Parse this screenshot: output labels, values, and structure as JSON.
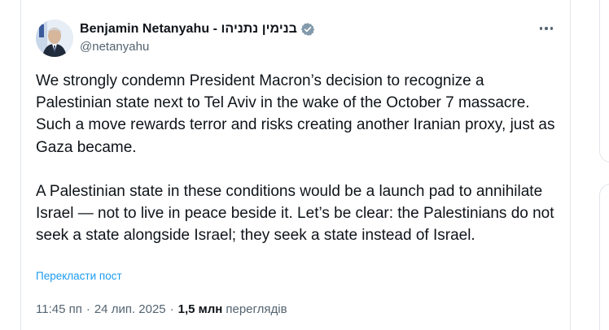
{
  "author": {
    "display_name": "Benjamin Netanyahu - בנימין נתניהו",
    "handle": "@netanyahu",
    "verified_icon": "verified-badge-gray",
    "avatar_icon": "profile-photo"
  },
  "menu": {
    "more_icon": "more-horizontal-icon"
  },
  "tweet": {
    "paragraph_1": "We strongly condemn President Macron’s decision to recognize a Palestinian state next to Tel Aviv in the wake of the October 7 massacre. Such a move rewards terror and risks creating another Iranian proxy, just as Gaza became.",
    "paragraph_2": "A Palestinian state in these conditions would be a launch pad to annihilate Israel — not to live in peace beside it. Let’s be clear: the Palestinians do not seek a state alongside Israel; they seek a state instead of Israel."
  },
  "translate_link": "Перекласти пост",
  "meta": {
    "time": "11:45 пп",
    "separator": "·",
    "date": "24 лип. 2025",
    "views_count": "1,5 млн",
    "views_label": "переглядів"
  },
  "colors": {
    "text_primary": "#0f1419",
    "text_secondary": "#536471",
    "link": "#1d9bf0",
    "border": "#e1e6ea",
    "verified": "#829aab"
  }
}
